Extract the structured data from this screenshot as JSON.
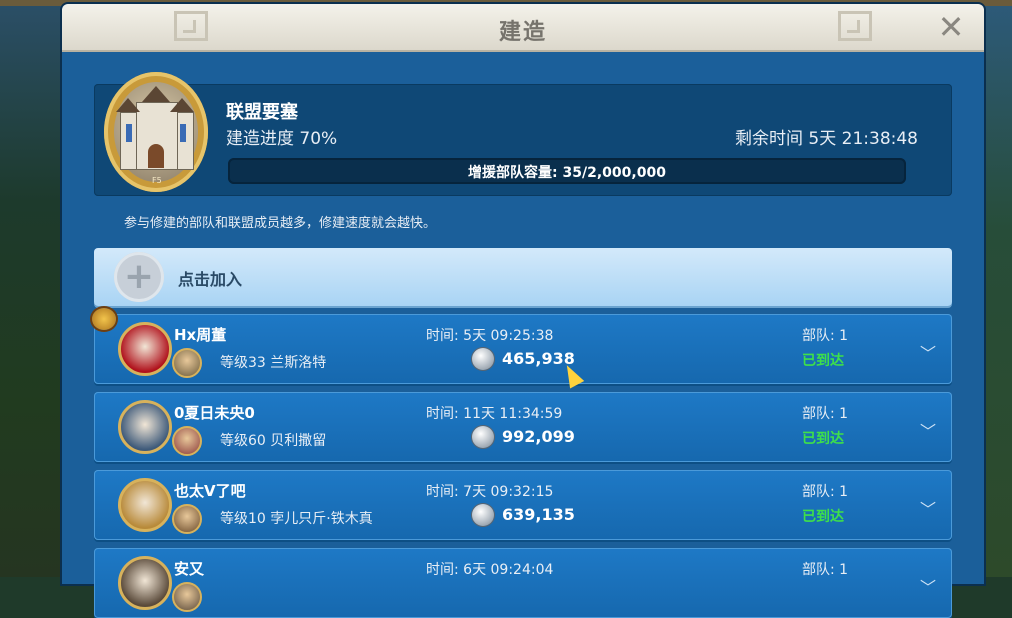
{
  "dialog": {
    "title": "建造",
    "close_icon": "close-icon"
  },
  "fortress": {
    "name": "联盟要塞",
    "progress_text": "建造进度 70%",
    "progress_value": 0.7,
    "remaining_text": "剩余时间 5天 21:38:48",
    "capacity_text": "增援部队容量: 35/2,000,000",
    "level_tag": "F5",
    "hint": "参与修建的部队和联盟成员越多，修建速度就会越快。"
  },
  "join": {
    "label": "点击加入",
    "icon": "plus-icon"
  },
  "members": [
    {
      "name": "Hx周董",
      "level": "等级33 兰斯洛特",
      "time": "时间:  5天 09:25:38",
      "amount": "465,938",
      "troops": "部队: 1",
      "status": "已到达",
      "avatar_color": "#b0121c",
      "hero_color": "#6a5a3a"
    },
    {
      "name": "0夏日未央0",
      "level": "等级60 贝利撒留",
      "time": "时间:  11天 11:34:59",
      "amount": "992,099",
      "troops": "部队: 1",
      "status": "已到达",
      "avatar_color": "#3e5a7a",
      "hero_color": "#8a3a3a"
    },
    {
      "name": "也太V了吧",
      "level": "等级10 孛儿只斤·铁木真",
      "time": "时间:  7天 09:32:15",
      "amount": "639,135",
      "troops": "部队: 1",
      "status": "已到达",
      "avatar_color": "#b88a3a",
      "hero_color": "#6a4a2a"
    },
    {
      "name": "安又",
      "level": "",
      "time": "时间:  6天 09:24:04",
      "amount": "",
      "troops": "部队: 1",
      "status": "",
      "avatar_color": "#5a4a3a",
      "hero_color": "#5a4a3a"
    }
  ],
  "colors": {
    "panel": "#1b5f9a",
    "row": "#1e79c6",
    "status_arrived": "#3ee04a",
    "title_bar": "#f4f2ea"
  }
}
